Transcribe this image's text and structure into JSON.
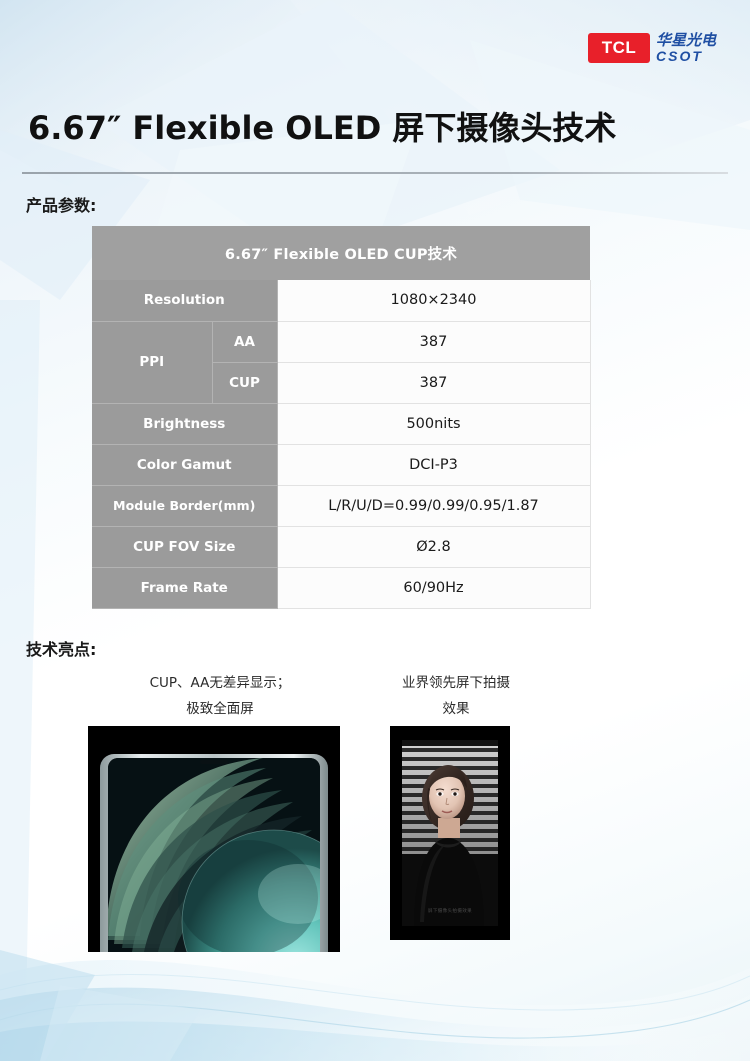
{
  "brand": {
    "logo_mark": "TCL",
    "logo_cn": "华星光电",
    "logo_latin": "CSOT",
    "logo_red": "#e8202a",
    "logo_blue": "#1f4fa3"
  },
  "title": "6.67″ Flexible OLED 屏下摄像头技术",
  "sections": {
    "params_label": "产品参数:",
    "highlights_label": "技术亮点:"
  },
  "spec_table": {
    "header": "6.67″   Flexible OLED CUP技术",
    "header_bg": "#a0a0a0",
    "label_bg": "#9b9b9b",
    "value_bg": "#fcfcfc",
    "rows": [
      {
        "label": "Resolution",
        "value": "1080×2340"
      },
      {
        "group": "PPI",
        "sub": "AA",
        "value": "387"
      },
      {
        "group": "PPI",
        "sub": "CUP",
        "value": "387"
      },
      {
        "label": "Brightness",
        "value": "500nits"
      },
      {
        "label": "Color Gamut",
        "value": "DCI-P3"
      },
      {
        "label": "Module Border(mm)",
        "value": "L/R/U/D=0.99/0.99/0.95/1.87"
      },
      {
        "label": "CUP FOV Size",
        "value": "Ø2.8"
      },
      {
        "label": "Frame Rate",
        "value": "60/90Hz"
      }
    ],
    "labels": {
      "resolution": "Resolution",
      "ppi": "PPI",
      "aa": "AA",
      "cup": "CUP",
      "brightness": "Brightness",
      "color_gamut": "Color Gamut",
      "module_border": "Module Border(mm)",
      "cup_fov": "CUP FOV Size",
      "frame_rate": "Frame Rate"
    },
    "values": {
      "resolution": "1080×2340",
      "ppi_aa": "387",
      "ppi_cup": "387",
      "brightness": "500nits",
      "color_gamut": "DCI-P3",
      "module_border": "L/R/U/D=0.99/0.99/0.95/1.87",
      "cup_fov": "Ø2.8",
      "frame_rate": "60/90Hz"
    }
  },
  "highlights": [
    {
      "caption_line1": "CUP、AA无差异显示；",
      "caption_line2": "极致全面屏",
      "image_name": "phone-fullscreen-photo"
    },
    {
      "caption_line1": "业界领先屏下拍摄",
      "caption_line2": "效果",
      "image_name": "under-display-camera-portrait-photo"
    }
  ],
  "watermark": "屏下摄像头拍摄效果"
}
